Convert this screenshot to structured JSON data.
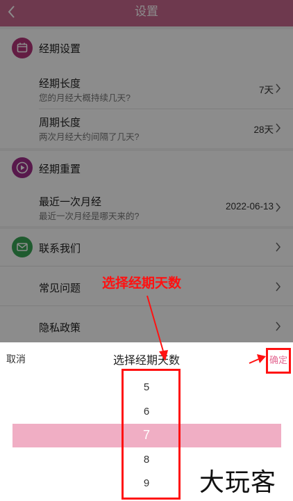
{
  "header": {
    "title": "设置"
  },
  "sections": {
    "period_settings": {
      "title": "经期设置"
    },
    "period_reset": {
      "title": "经期重置"
    },
    "contact": {
      "title": "联系我们"
    }
  },
  "rows": {
    "period_length": {
      "title": "经期长度",
      "subtitle": "您的月经大概持续几天?",
      "value": "7天"
    },
    "cycle_length": {
      "title": "周期长度",
      "subtitle": "两次月经大约间隔了几天?",
      "value": "28天"
    },
    "last_period": {
      "title": "最近一次月经",
      "subtitle": "最近一次月经是哪天来的?",
      "value": "2022-06-13"
    },
    "faq": {
      "title": "常见问题"
    },
    "privacy": {
      "title": "隐私政策"
    }
  },
  "picker": {
    "cancel": "取消",
    "title": "选择经期天数",
    "confirm": "确定",
    "options": [
      "5",
      "6",
      "7",
      "8",
      "9"
    ],
    "selected": "7"
  },
  "annotation": {
    "label": "选择经期天数"
  },
  "watermark": "大玩客",
  "colors": {
    "header": "#c9698f",
    "accent": "#e46a93",
    "selection_band": "#f0aec4",
    "annotation": "#ff1111",
    "icon_period_settings": "#b5367a",
    "icon_period_reset": "#a12e8a",
    "icon_contact": "#3aa757"
  },
  "icons": {
    "back": "back-arrow-icon",
    "period_settings": "calendar-icon",
    "period_reset": "play-icon",
    "contact": "mail-icon",
    "row_chevron": "chevron-right-icon"
  }
}
